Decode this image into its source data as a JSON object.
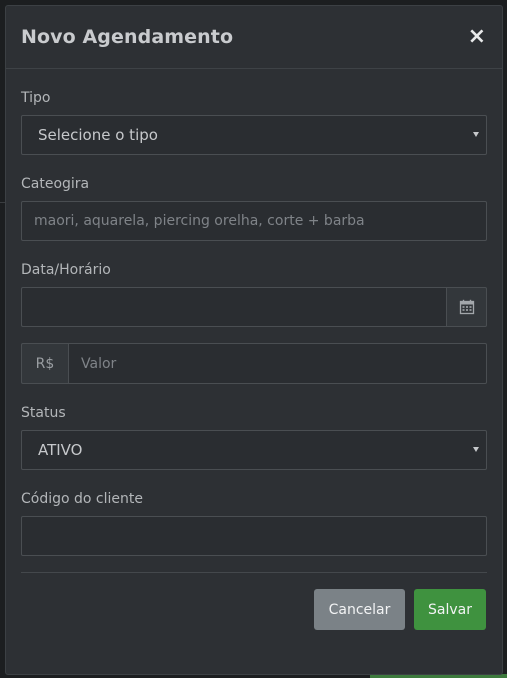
{
  "modal": {
    "title": "Novo Agendamento",
    "close_label": "×"
  },
  "form": {
    "tipo": {
      "label": "Tipo",
      "value": "Selecione o tipo"
    },
    "categoria": {
      "label": "Cateogira",
      "placeholder": "maori, aquarela, piercing orelha, corte + barba"
    },
    "data": {
      "label": "Data/Horário",
      "value": ""
    },
    "valor": {
      "prefix": "R$",
      "placeholder": "Valor"
    },
    "status": {
      "label": "Status",
      "value": "ATIVO"
    },
    "codigo": {
      "label": "Código do cliente",
      "value": ""
    }
  },
  "footer": {
    "cancel_label": "Cancelar",
    "save_label": "Salvar"
  },
  "icons": {
    "calendar": "calendar-icon",
    "close": "close-icon"
  },
  "colors": {
    "modal_bg": "#2d3034",
    "save": "#3f923f",
    "cancel": "#7b8287"
  }
}
